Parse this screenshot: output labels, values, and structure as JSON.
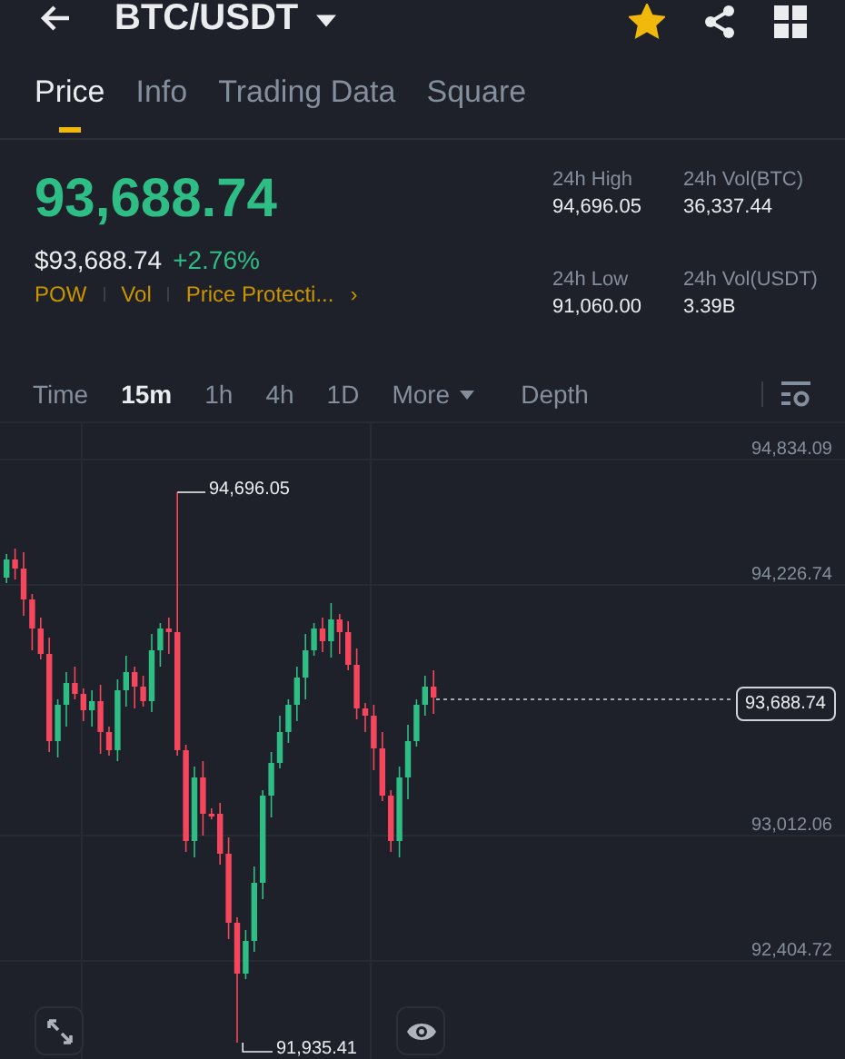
{
  "header": {
    "title": "BTC/USDT",
    "favorite": true
  },
  "tabs": [
    {
      "label": "Price",
      "selected": true
    },
    {
      "label": "Info",
      "selected": false
    },
    {
      "label": "Trading Data",
      "selected": false
    },
    {
      "label": "Square",
      "selected": false
    }
  ],
  "ticker": {
    "last_price": "93,688.74",
    "usd_price": "$93,688.74",
    "change": "+2.76%",
    "tags": [
      "POW",
      "Vol",
      "Price Protecti..."
    ],
    "more": "›"
  },
  "stats": [
    {
      "label": "24h High",
      "value": "94,696.05"
    },
    {
      "label": "24h Vol(BTC)",
      "value": "36,337.44"
    },
    {
      "label": "24h Low",
      "value": "91,060.00"
    },
    {
      "label": "24h Vol(USDT)",
      "value": "3.39B"
    }
  ],
  "intervals": [
    {
      "label": "Time",
      "selected": false
    },
    {
      "label": "15m",
      "selected": true
    },
    {
      "label": "1h",
      "selected": false
    },
    {
      "label": "4h",
      "selected": false
    },
    {
      "label": "1D",
      "selected": false
    },
    {
      "label": "More",
      "selected": false,
      "kind": "dropdown"
    },
    {
      "label": "Depth",
      "selected": false
    }
  ],
  "chart": {
    "price_ticks": [
      "94,834.09",
      "94,226.74",
      "93,012.06",
      "92,404.72"
    ],
    "high_label": "94,696.05",
    "low_label": "91,935.41",
    "current_price": "93,688.74"
  }
}
